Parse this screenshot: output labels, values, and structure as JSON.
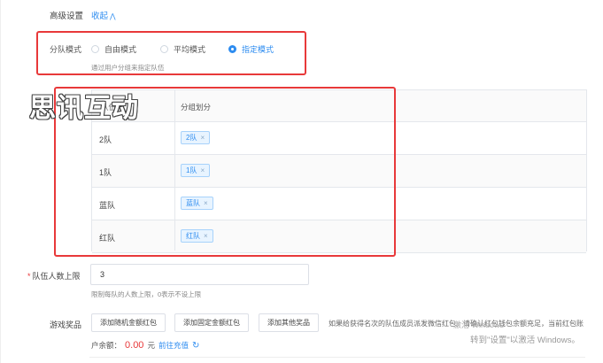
{
  "advanced": {
    "label": "高级设置",
    "toggle": "收起"
  },
  "mode": {
    "label": "分队模式",
    "options": [
      "自由模式",
      "平均模式",
      "指定模式"
    ],
    "selected": "指定模式",
    "help": "通过用户分组来指定队伍"
  },
  "watermark": "思讯互动",
  "group_table": {
    "headers": [
      "队伍",
      "分组划分"
    ],
    "rows": [
      {
        "name": "2队",
        "tag": "2队"
      },
      {
        "name": "1队",
        "tag": "1队"
      },
      {
        "name": "蓝队",
        "tag": "蓝队"
      },
      {
        "name": "红队",
        "tag": "红队"
      }
    ]
  },
  "team_limit": {
    "required_mark": "*",
    "label": "队伍人数上限",
    "value": "3",
    "help": "限制每队的人数上限，0表示不设上限"
  },
  "prizes": {
    "label": "游戏奖品",
    "buttons": [
      "添加随机金额红包",
      "添加固定金额红包",
      "添加其他奖品"
    ],
    "help": "如果给获得名次的队伍成员派发微信红包，请确认红包钱包余额充足，当前红包账"
  },
  "windows_activation": {
    "line1": "激活 Windows",
    "line2": "转到\"设置\"以激活 Windows。"
  },
  "balance": {
    "label": "户余额：",
    "amount": "0.00",
    "unit": "元",
    "link": "前往充值"
  },
  "colors": {
    "accent": "#2d8cf0",
    "highlight_border": "#e8393a",
    "amount": "#e8393a"
  }
}
